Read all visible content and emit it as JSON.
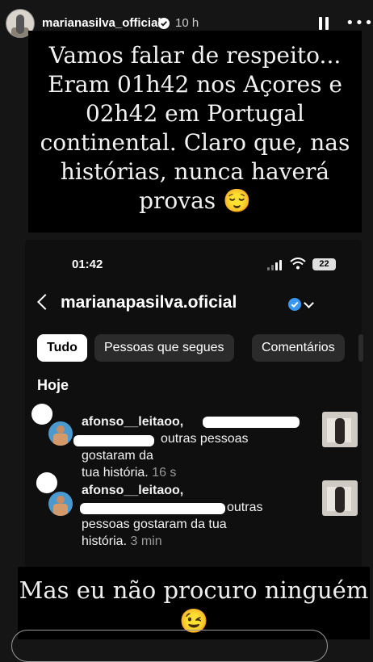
{
  "story": {
    "username": "marianasilva_official",
    "time_ago": "10 h",
    "caption_top": "Vamos falar de respeito... Eram 01h42 nos Açores e 02h42 em Portugal continental. Claro que, nas histórias, nunca haverá provas 😌",
    "caption_bottom": "Mas eu não procuro ninguém 😉"
  },
  "screenshot": {
    "status_time": "01:42",
    "battery": "22",
    "account": "marianapasilva.oficial",
    "tabs": [
      {
        "label": "Tudo",
        "active": true
      },
      {
        "label": "Pessoas que segues",
        "active": false
      },
      {
        "label": "Comentários",
        "active": false
      }
    ],
    "section_heading": "Hoje",
    "notifications": [
      {
        "user": "afonso__leitaoo,",
        "line2_visible": "outras pessoas gostaram da",
        "line3": "tua história.",
        "time": "16 s"
      },
      {
        "user": "afonso__leitaoo,",
        "line2_visible": "outras",
        "line3": "pessoas gostaram da tua",
        "line4": "história.",
        "time": "3 min"
      }
    ]
  },
  "colors": {
    "background": "#151515",
    "caption_box": "#000000",
    "verified_blue": "#3897f0",
    "timestamp_gray": "#9a9a9a"
  }
}
